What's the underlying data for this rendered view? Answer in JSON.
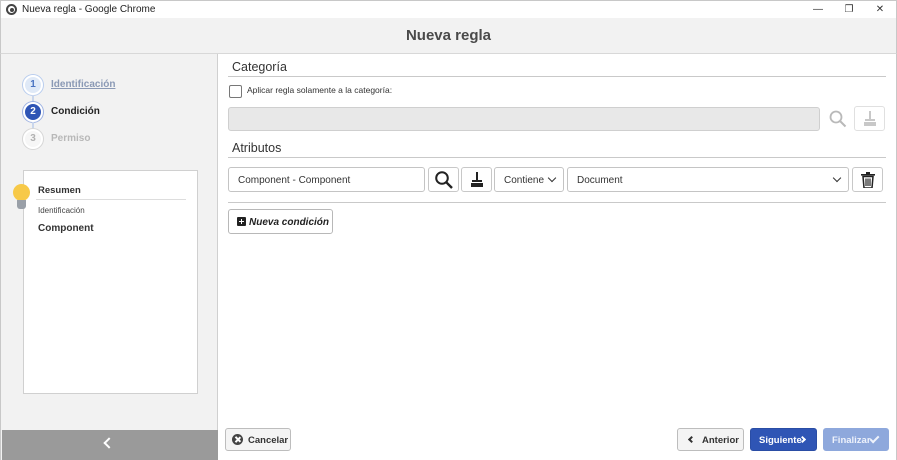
{
  "window": {
    "title": "Nueva regla - Google Chrome",
    "controls": [
      "minimize",
      "restore",
      "close"
    ]
  },
  "dialog": {
    "title": "Nueva regla"
  },
  "wizard": {
    "steps": [
      {
        "number": "1",
        "label": "Identificación",
        "state": "completed"
      },
      {
        "number": "2",
        "label": "Condición",
        "state": "active"
      },
      {
        "number": "3",
        "label": "Permiso",
        "state": "disabled"
      }
    ]
  },
  "summary": {
    "title": "Resumen",
    "field_label": "Identificación",
    "field_value": "Component",
    "icon": "lightbulb-icon"
  },
  "category": {
    "section_title": "Categoría",
    "checkbox_label": "Aplicar regla solamente a la categoría:",
    "checkbox_checked": false,
    "value": ""
  },
  "attributes": {
    "section_title": "Atributos",
    "condition": {
      "attribute_value": "Component - Component",
      "operator": "Contiene",
      "value": "Document"
    }
  },
  "actions": {
    "new_condition": "Nueva condición",
    "cancel": "Cancelar",
    "previous": "Anterior",
    "next": "Siguiente",
    "finish": "Finalizar"
  },
  "colors": {
    "primary": "#2f55b5",
    "primary_disabled": "#8ea8dc",
    "sidebar_bg": "#f2f2f2",
    "collapse_bar": "#9a9a9a",
    "lightbulb": "#f7c948"
  }
}
